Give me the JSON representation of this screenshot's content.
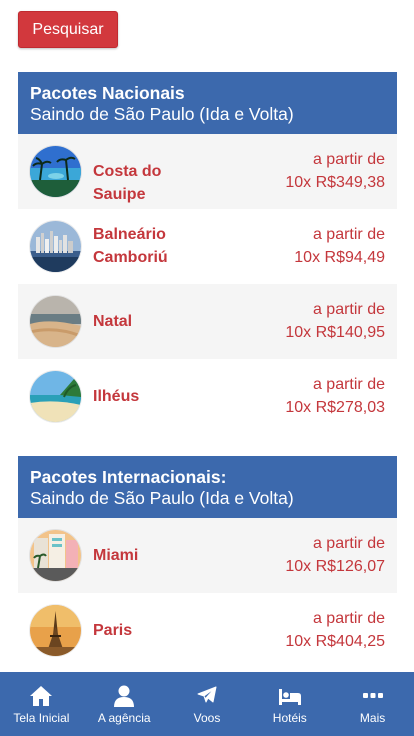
{
  "search": {
    "label": "Pesquisar"
  },
  "national": {
    "title": "Pacotes Nacionais",
    "subtitle": "Saindo de São Paulo (Ida e Volta)",
    "items": [
      {
        "name_line1": "Costa do Sauipe",
        "name_line2": "",
        "price_prefix": "a partir de",
        "price": "10x R$349,38",
        "image": "beach-palms"
      },
      {
        "name_line1": "Balneário",
        "name_line2": "Camboriú",
        "price_prefix": "a partir de",
        "price": "10x R$94,49",
        "image": "city-coast"
      },
      {
        "name_line1": "Natal",
        "name_line2": "",
        "price_prefix": "a partir de",
        "price": "10x R$140,95",
        "image": "dunes-beach"
      },
      {
        "name_line1": "Ilhéus",
        "name_line2": "",
        "price_prefix": "a partir de",
        "price": "10x R$278,03",
        "image": "tropical-beach"
      }
    ]
  },
  "international": {
    "title": "Pacotes Internacionais:",
    "subtitle": "Saindo de São Paulo (Ida e Volta)",
    "items": [
      {
        "name_line1": "Miami",
        "name_line2": "",
        "price_prefix": "a partir de",
        "price": "10x R$126,07",
        "image": "art-deco-street"
      },
      {
        "name_line1": "Paris",
        "name_line2": "",
        "price_prefix": "a partir de",
        "price": "10x R$404,25",
        "image": "eiffel-tower"
      }
    ]
  },
  "nav": {
    "items": [
      {
        "label": "Tela Inicial",
        "icon": "home-icon"
      },
      {
        "label": "A agência",
        "icon": "user-icon"
      },
      {
        "label": "Voos",
        "icon": "plane-icon"
      },
      {
        "label": "Hotéis",
        "icon": "bed-icon"
      },
      {
        "label": "Mais",
        "icon": "more-icon"
      }
    ]
  },
  "colors": {
    "header_blue": "#3c69ad",
    "accent_red": "#c4373c",
    "button_red": "#d2383d",
    "row_shade": "#f5f5f5"
  }
}
